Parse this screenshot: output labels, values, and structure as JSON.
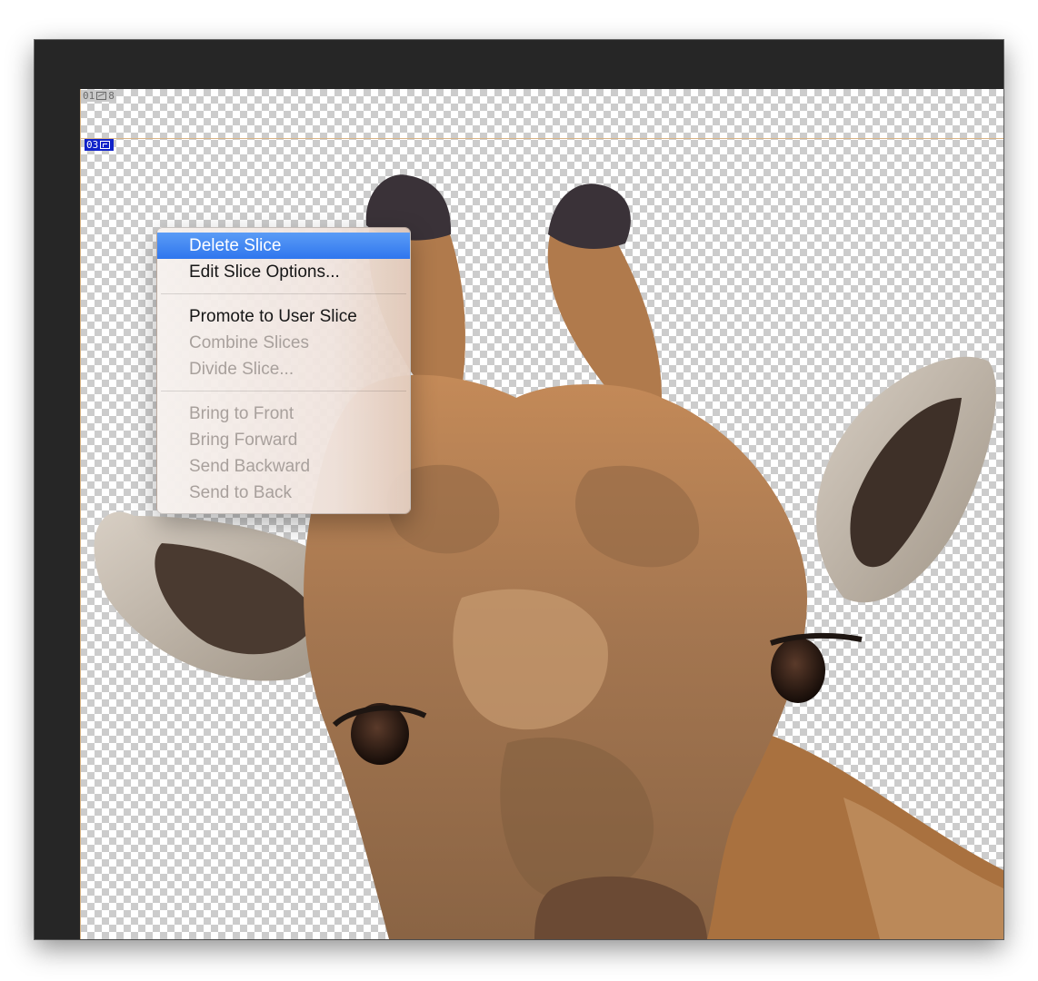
{
  "canvas": {
    "auto_slice": {
      "number": "01",
      "suffix": "8",
      "icon": "image-icon"
    },
    "user_slice": {
      "number": "03",
      "icon": "layer-icon",
      "color": "#1022c9"
    },
    "slice_line_color": "#d9b486"
  },
  "context_menu": {
    "highlight_color": "#2f76ee",
    "items": [
      {
        "label": "Delete Slice",
        "state": "highlighted"
      },
      {
        "label": "Edit Slice Options...",
        "state": "enabled"
      },
      {
        "label": "Promote to User Slice",
        "state": "enabled"
      },
      {
        "label": "Combine Slices",
        "state": "disabled"
      },
      {
        "label": "Divide Slice...",
        "state": "disabled"
      },
      {
        "label": "Bring to Front",
        "state": "disabled"
      },
      {
        "label": "Bring Forward",
        "state": "disabled"
      },
      {
        "label": "Send Backward",
        "state": "disabled"
      },
      {
        "label": "Send to Back",
        "state": "disabled"
      }
    ]
  }
}
